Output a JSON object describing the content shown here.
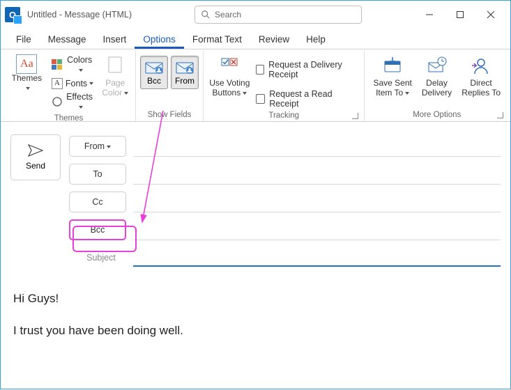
{
  "window": {
    "title": "Untitled  -  Message (HTML)",
    "search_placeholder": "Search"
  },
  "tabs": {
    "file": "File",
    "message": "Message",
    "insert": "Insert",
    "options": "Options",
    "format_text": "Format Text",
    "review": "Review",
    "help": "Help"
  },
  "ribbon": {
    "themes": {
      "themes": "Themes",
      "colors": "Colors",
      "fonts": "Fonts",
      "effects": "Effects",
      "page_color": "Page\nColor",
      "group": "Themes"
    },
    "show_fields": {
      "bcc": "Bcc",
      "from": "From",
      "group": "Show Fields"
    },
    "tracking": {
      "use_voting": "Use Voting\nButtons",
      "delivery_receipt": "Request a Delivery Receipt",
      "read_receipt": "Request a Read Receipt",
      "group": "Tracking"
    },
    "more_options": {
      "save_sent": "Save Sent\nItem To",
      "delay": "Delay\nDelivery",
      "direct": "Direct\nReplies To",
      "group": "More Options"
    }
  },
  "compose": {
    "send": "Send",
    "from": "From",
    "to": "To",
    "cc": "Cc",
    "bcc": "Bcc",
    "subject_label": "Subject"
  },
  "body": {
    "line1": "Hi Guys!",
    "line2": "I trust you have been doing well."
  }
}
